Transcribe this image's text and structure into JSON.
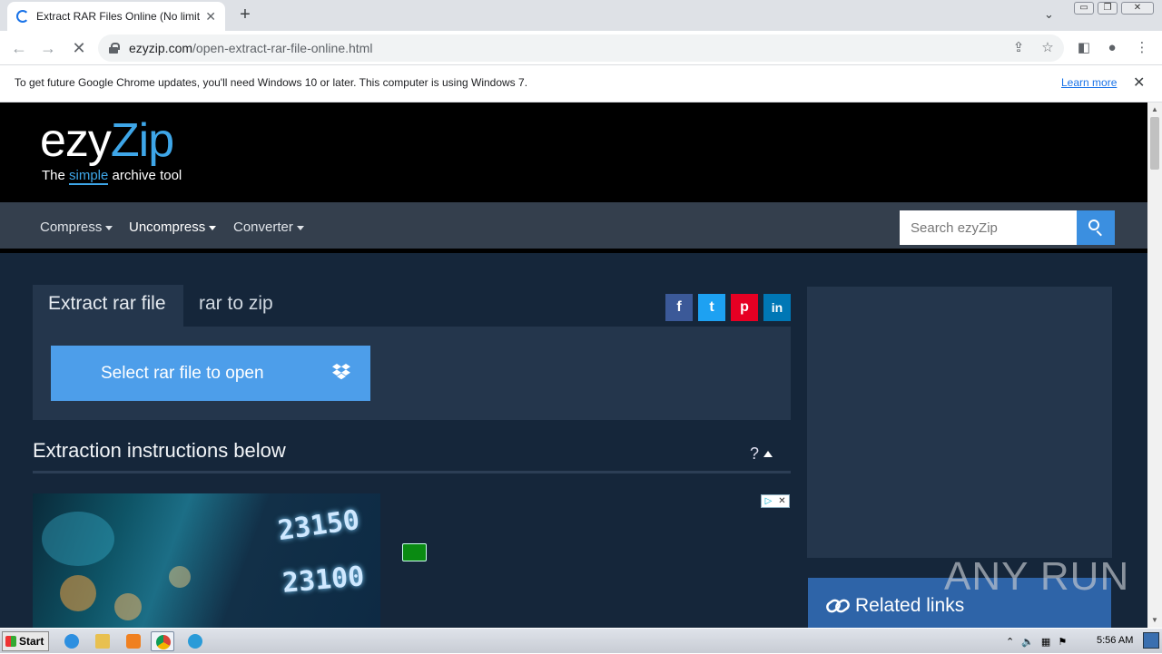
{
  "browser": {
    "tab_title": "Extract RAR Files Online (No limits!)",
    "new_tab_label": "+",
    "url_host": "ezyzip.com",
    "url_path": "/open-extract-rar-file-online.html"
  },
  "infobar": {
    "message": "To get future Google Chrome updates, you'll need Windows 10 or later. This computer is using Windows 7.",
    "learn_more": "Learn more"
  },
  "logo": {
    "ezy": "ezy",
    "zip": "Zip",
    "tag_the": "The ",
    "tag_simple": "simple",
    "tag_rest": " archive tool"
  },
  "nav": {
    "items": [
      {
        "label": "Compress"
      },
      {
        "label": "Uncompress"
      },
      {
        "label": "Converter"
      }
    ],
    "search_placeholder": "Search ezyZip"
  },
  "tabs": [
    {
      "label": "Extract rar file"
    },
    {
      "label": "rar to zip"
    }
  ],
  "social": [
    {
      "icon": "facebook-icon",
      "glyph": "f",
      "color": "#3b5998"
    },
    {
      "icon": "twitter-icon",
      "glyph": "t",
      "color": "#1da1f2"
    },
    {
      "icon": "pinterest-icon",
      "glyph": "p",
      "color": "#e60023"
    },
    {
      "icon": "linkedin-icon",
      "glyph": "in",
      "color": "#0077b5"
    }
  ],
  "select_button": "Select rar file to open",
  "instructions": {
    "title": "Extraction instructions below",
    "help": "?"
  },
  "ad": {
    "num1": "23150",
    "num2": "23100"
  },
  "sidebar": {
    "related_links": "Related links"
  },
  "watermark": "ANY RUN",
  "taskbar": {
    "start": "Start",
    "clock": "5:56 AM"
  },
  "colors": {
    "page_bg": "#15263a",
    "panel_bg": "#24364c",
    "accent": "#4d9eea",
    "navbar_bg": "#343f4d"
  }
}
